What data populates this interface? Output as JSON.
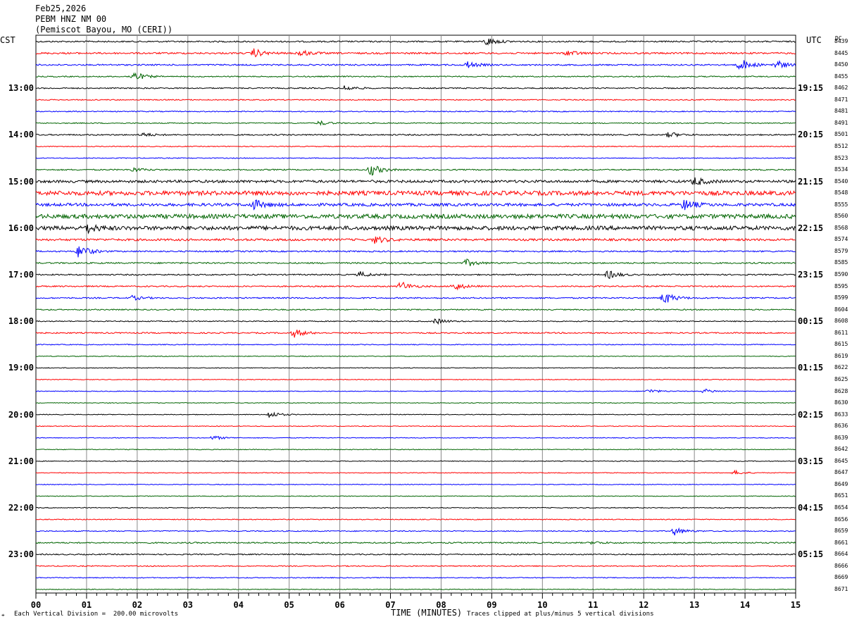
{
  "header": {
    "date": "Feb25,2026",
    "station": "PEBM HNZ NM 00",
    "location": "(Pemiscot Bayou, MO (CERI))"
  },
  "left_tz": "CST",
  "right_tz": "UTC",
  "dc_label": "DC",
  "footer": {
    "scale_note": "Each Vertical Division =  200.00 microvolts",
    "xlabel": "TIME (MINUTES)",
    "clip_note": "Traces clipped at plus/minus 5 vertical divisions"
  },
  "colors": [
    "#000000",
    "#ff0000",
    "#0000ff",
    "#006400"
  ],
  "chart_data": {
    "type": "line",
    "title": "PEBM HNZ NM 00",
    "xlabel": "TIME (MINUTES)",
    "xlim": [
      0,
      15
    ],
    "x_ticks": [
      "00",
      "01",
      "02",
      "03",
      "04",
      "05",
      "06",
      "07",
      "08",
      "09",
      "10",
      "11",
      "12",
      "13",
      "14",
      "15"
    ],
    "left_hour_labels": [
      "13:00",
      "14:00",
      "15:00",
      "16:00",
      "17:00",
      "18:00",
      "19:00",
      "20:00",
      "21:00",
      "22:00",
      "23:00"
    ],
    "right_hour_labels": [
      "19:15",
      "20:15",
      "21:15",
      "22:15",
      "23:15",
      "00:15",
      "01:15",
      "02:15",
      "03:15",
      "04:15",
      "05:15"
    ],
    "dc_offsets": [
      "8439",
      "8445",
      "8450",
      "8455",
      "8462",
      "8471",
      "8481",
      "8491",
      "8501",
      "8512",
      "8523",
      "8534",
      "8540",
      "8548",
      "8555",
      "8560",
      "8568",
      "8574",
      "8579",
      "8585",
      "8590",
      "8595",
      "8599",
      "8604",
      "8608",
      "8611",
      "8615",
      "8619",
      "8622",
      "8625",
      "8628",
      "8630",
      "8633",
      "8636",
      "8639",
      "8642",
      "8645",
      "8647",
      "8649",
      "8651",
      "8654",
      "8656",
      "8659",
      "8661",
      "8664",
      "8666",
      "8669",
      "8671"
    ],
    "trace_noise_levels": [
      1.0,
      1.2,
      1.0,
      0.8,
      0.8,
      0.7,
      0.7,
      0.7,
      0.9,
      0.6,
      0.6,
      0.9,
      1.8,
      3.0,
      2.0,
      3.0,
      2.8,
      1.5,
      1.0,
      1.0,
      0.9,
      0.9,
      0.9,
      0.8,
      0.7,
      0.9,
      0.6,
      0.5,
      0.5,
      0.5,
      0.5,
      0.5,
      0.5,
      0.5,
      0.5,
      0.5,
      0.5,
      0.5,
      0.5,
      0.5,
      0.6,
      0.6,
      0.7,
      0.9,
      0.8,
      0.7,
      0.6,
      0.5
    ],
    "events": [
      {
        "trace": 0,
        "minute": 8.9,
        "amp": 6
      },
      {
        "trace": 1,
        "minute": 4.3,
        "amp": 6
      },
      {
        "trace": 1,
        "minute": 5.2,
        "amp": 5
      },
      {
        "trace": 1,
        "minute": 10.5,
        "amp": 4
      },
      {
        "trace": 2,
        "minute": 8.5,
        "amp": 5
      },
      {
        "trace": 2,
        "minute": 13.9,
        "amp": 9
      },
      {
        "trace": 2,
        "minute": 14.6,
        "amp": 7
      },
      {
        "trace": 3,
        "minute": 1.9,
        "amp": 8
      },
      {
        "trace": 4,
        "minute": 6.1,
        "amp": 4
      },
      {
        "trace": 7,
        "minute": 5.6,
        "amp": 3
      },
      {
        "trace": 8,
        "minute": 2.1,
        "amp": 3
      },
      {
        "trace": 8,
        "minute": 12.5,
        "amp": 4
      },
      {
        "trace": 11,
        "minute": 6.6,
        "amp": 9
      },
      {
        "trace": 11,
        "minute": 1.9,
        "amp": 3
      },
      {
        "trace": 12,
        "minute": 13.0,
        "amp": 6
      },
      {
        "trace": 14,
        "minute": 4.3,
        "amp": 7
      },
      {
        "trace": 14,
        "minute": 12.8,
        "amp": 7
      },
      {
        "trace": 16,
        "minute": 1.0,
        "amp": 6
      },
      {
        "trace": 17,
        "minute": 6.7,
        "amp": 5
      },
      {
        "trace": 18,
        "minute": 0.85,
        "amp": 10
      },
      {
        "trace": 19,
        "minute": 8.5,
        "amp": 5
      },
      {
        "trace": 20,
        "minute": 11.3,
        "amp": 6
      },
      {
        "trace": 20,
        "minute": 6.4,
        "amp": 4
      },
      {
        "trace": 21,
        "minute": 7.2,
        "amp": 7
      },
      {
        "trace": 21,
        "minute": 8.25,
        "amp": 6
      },
      {
        "trace": 22,
        "minute": 12.4,
        "amp": 9
      },
      {
        "trace": 22,
        "minute": 1.9,
        "amp": 3
      },
      {
        "trace": 24,
        "minute": 7.9,
        "amp": 4
      },
      {
        "trace": 25,
        "minute": 5.1,
        "amp": 6
      },
      {
        "trace": 30,
        "minute": 12.1,
        "amp": 3
      },
      {
        "trace": 30,
        "minute": 13.2,
        "amp": 3
      },
      {
        "trace": 32,
        "minute": 4.6,
        "amp": 5
      },
      {
        "trace": 34,
        "minute": 3.5,
        "amp": 3
      },
      {
        "trace": 37,
        "minute": 13.8,
        "amp": 3
      },
      {
        "trace": 42,
        "minute": 12.6,
        "amp": 6
      },
      {
        "trace": 43,
        "minute": 11.0,
        "amp": 2
      }
    ]
  }
}
